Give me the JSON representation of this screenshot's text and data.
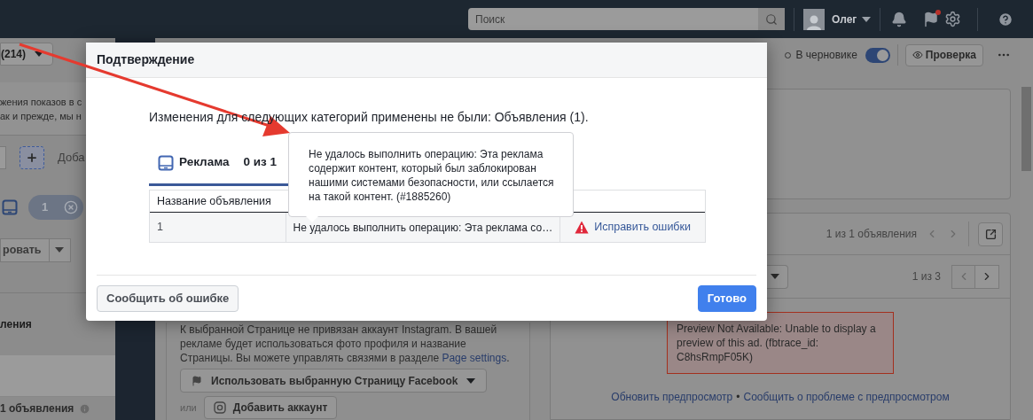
{
  "top_bar": {
    "search": {
      "placeholder": "Поиск"
    },
    "user_name": "Олег"
  },
  "left_panel": {
    "dropdown_label": "(214)",
    "text_lines": [
      "жения показов в с",
      "ак и прежде, мы н"
    ],
    "add_label": "Доба",
    "pill_count": "1",
    "action_button": "ровать",
    "section_title": "ления",
    "footer_count": "1 объявления"
  },
  "center_panel": {
    "paragraph": "К выбранной Странице не привязан аккаунт Instagram. В вашей рекламе будет использоваться фото профиля и название Страницы. Вы можете управлять связями в разделе ",
    "paragraph_link": "Page settings",
    "paragraph_end": ".",
    "page_button": "Использовать выбранную Страницу Facebook",
    "or_label": "или",
    "add_account_button": "Добавить аккаунт"
  },
  "right_panel": {
    "status": "В черновике",
    "toggle": {
      "on": true
    },
    "review_button": "Проверка",
    "ad_counter": "1 из 1 объявления",
    "placement_counter": "1 из 3",
    "preview_error": "Preview Not Available: Unable to display a preview of this ad. (fbtrace_id: C8hsRmpF05K)",
    "links": [
      "Обновить предпросмотр",
      "Сообщить о проблеме с предпросмотром"
    ],
    "separator": "•"
  },
  "dialog": {
    "title": "Подтверждение",
    "message": "Изменения для следующих категорий применены не были: Объявления (1).",
    "tabs": [
      {
        "label": "Реклама",
        "count": "0 из 1",
        "selected": true
      }
    ],
    "table": {
      "columns": [
        "Название объявления"
      ],
      "rows": [
        {
          "name": "1",
          "error": "Не удалось выполнить операцию: Эта реклама со…",
          "action": "Исправить ошибки"
        }
      ]
    },
    "tooltip": "Не удалось выполнить операцию: Эта реклама содержит контент, который был заблокирован нашими системами безопасности, или ссылается на такой контент. (#1885260)",
    "buttons": [
      {
        "label": "Сообщить об ошибке",
        "kind": "secondary"
      },
      {
        "label": "Готово",
        "kind": "primary"
      }
    ]
  }
}
